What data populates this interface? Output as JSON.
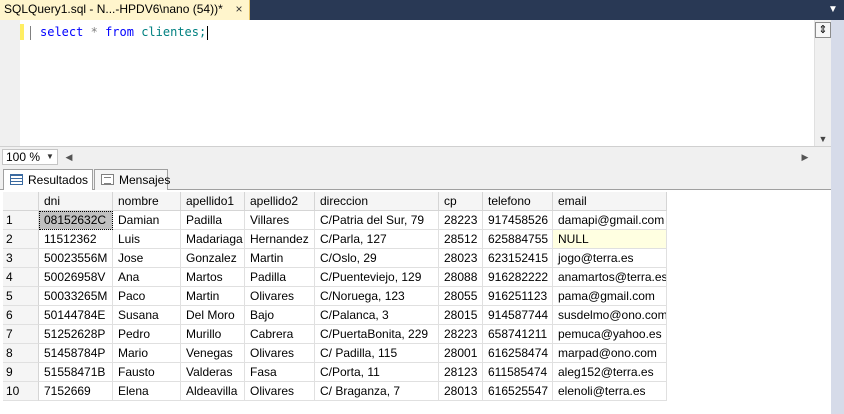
{
  "document_tab": {
    "title": "SQLQuery1.sql - N...-HPDV6\\nano (54))*",
    "close_glyph": "×",
    "overflow_glyph": "▼"
  },
  "editor": {
    "keyword_select": "select",
    "star": "*",
    "keyword_from": "from",
    "table_ref": "clientes;"
  },
  "zoom": {
    "value": "100 %"
  },
  "result_tabs": [
    {
      "label": "Resultados",
      "icon": "grid-icon"
    },
    {
      "label": "Mensajes",
      "icon": "messages-icon"
    }
  ],
  "grid": {
    "columns": [
      "dni",
      "nombre",
      "apellido1",
      "apellido2",
      "direccion",
      "cp",
      "telefono",
      "email"
    ],
    "rows": [
      [
        "1",
        "08152632C",
        "Damian",
        "Padilla",
        "Villares",
        "C/Patria del Sur, 79",
        "28223",
        "917458526",
        "damapi@gmail.com"
      ],
      [
        "2",
        "11512362",
        "Luis",
        "Madariaga",
        "Hernandez",
        "C/Parla, 127",
        "28512",
        "625884755",
        "NULL"
      ],
      [
        "3",
        "50023556M",
        "Jose",
        "Gonzalez",
        "Martin",
        "C/Oslo, 29",
        "28023",
        "623152415",
        "jogo@terra.es"
      ],
      [
        "4",
        "50026958V",
        "Ana",
        "Martos",
        "Padilla",
        "C/Puenteviejo, 129",
        "28088",
        "916282222",
        "anamartos@terra.es"
      ],
      [
        "5",
        "50033265M",
        "Paco",
        "Martin",
        "Olivares",
        "C/Noruega, 123",
        "28055",
        "916251123",
        "pama@gmail.com"
      ],
      [
        "6",
        "50144784E",
        "Susana",
        "Del Moro",
        "Bajo",
        "C/Palanca, 3",
        "28015",
        "914587744",
        "susdelmo@ono.com"
      ],
      [
        "7",
        "51252628P",
        "Pedro",
        "Murillo",
        "Cabrera",
        "C/PuertaBonita, 229",
        "28223",
        "658741211",
        "pemuca@yahoo.es"
      ],
      [
        "8",
        "51458784P",
        "Mario",
        "Venegas",
        "Olivares",
        "C/ Padilla, 115",
        "28001",
        "616258474",
        "marpad@ono.com"
      ],
      [
        "9",
        "51558471B",
        "Fausto",
        "Valderas",
        "Fasa",
        "C/Porta, 11",
        "28123",
        "611585474",
        "aleg152@terra.es"
      ],
      [
        "10",
        "7152669",
        "Elena",
        "Aldeavilla",
        "Olivares",
        "C/ Braganza, 7",
        "28013",
        "616525547",
        "elenoli@terra.es"
      ]
    ]
  },
  "colors": {
    "tab_strip": "#293955",
    "active_doc_tab": "#fff5cc",
    "keyword": "#0000ff",
    "identifier": "#008080",
    "null_cell": "#ffffe1"
  }
}
